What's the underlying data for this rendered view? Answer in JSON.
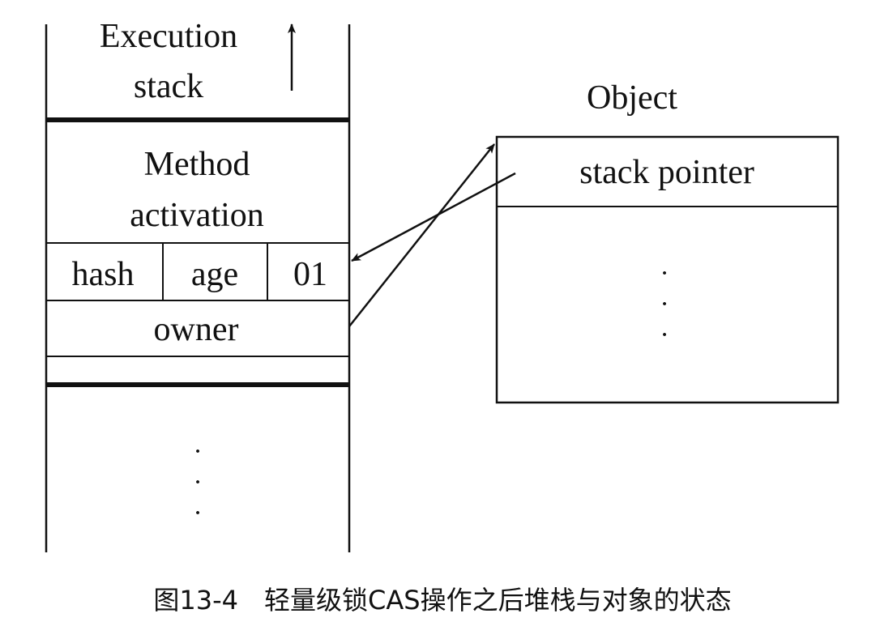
{
  "execution_stack": {
    "title_line1": "Execution",
    "title_line2": "stack",
    "method_line1": "Method",
    "method_line2": "activation",
    "hash": "hash",
    "age": "age",
    "bits": "01",
    "owner": "owner",
    "ellipsis": [
      "·",
      "·",
      "·"
    ]
  },
  "object": {
    "title": "Object",
    "stack_pointer": "stack pointer",
    "ellipsis": [
      "·",
      "·",
      "·"
    ]
  },
  "caption": "图13-4　轻量级锁CAS操作之后堆栈与对象的状态"
}
